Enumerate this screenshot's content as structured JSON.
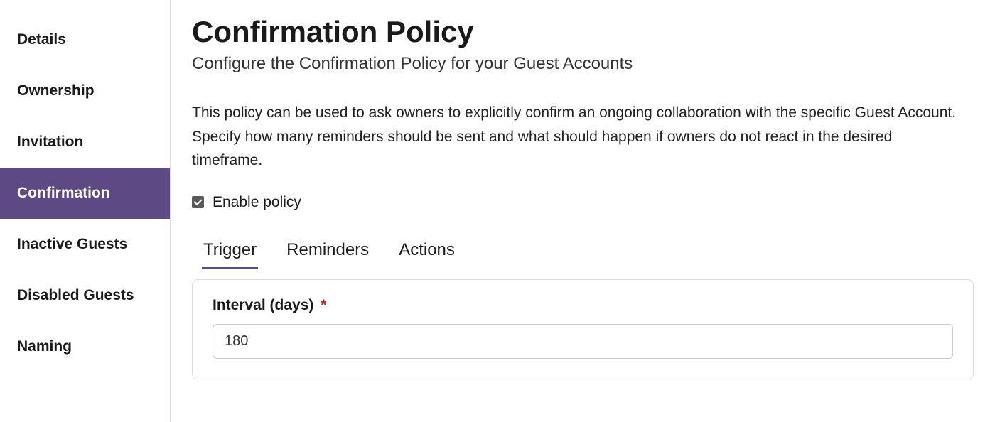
{
  "sidebar": {
    "items": [
      {
        "label": "Details",
        "active": false
      },
      {
        "label": "Ownership",
        "active": false
      },
      {
        "label": "Invitation",
        "active": false
      },
      {
        "label": "Confirmation",
        "active": true
      },
      {
        "label": "Inactive Guests",
        "active": false
      },
      {
        "label": "Disabled Guests",
        "active": false
      },
      {
        "label": "Naming",
        "active": false
      }
    ]
  },
  "main": {
    "title": "Confirmation Policy",
    "subtitle": "Configure the Confirmation Policy for your Guest Accounts",
    "description": "This policy can be used to ask owners to explicitly confirm an ongoing collaboration with the specific Guest Account. Specify how many reminders should be sent and what should happen if owners do not react in the desired timeframe.",
    "enable_policy": {
      "checked": true,
      "label": "Enable policy"
    },
    "tabs": [
      {
        "label": "Trigger",
        "active": true
      },
      {
        "label": "Reminders",
        "active": false
      },
      {
        "label": "Actions",
        "active": false
      }
    ],
    "form": {
      "interval": {
        "label": "Interval (days)",
        "required_mark": "*",
        "value": "180"
      }
    }
  }
}
